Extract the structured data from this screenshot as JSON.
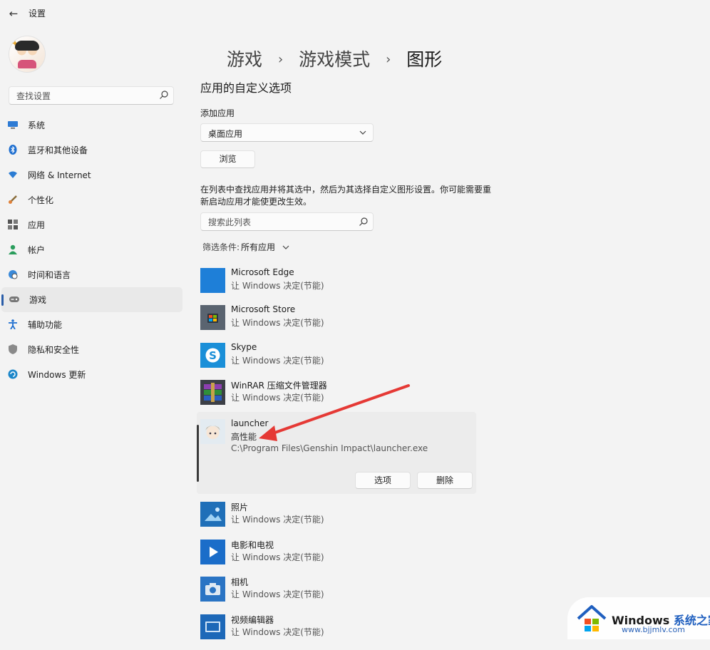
{
  "window": {
    "title": "设置",
    "back_icon": "back-arrow-icon"
  },
  "sidebar": {
    "search_placeholder": "查找设置",
    "items": [
      {
        "label": "系统",
        "icon": "monitor-icon",
        "active": false
      },
      {
        "label": "蓝牙和其他设备",
        "icon": "bluetooth-icon",
        "active": false
      },
      {
        "label": "网络 & Internet",
        "icon": "wifi-icon",
        "active": false
      },
      {
        "label": "个性化",
        "icon": "brush-icon",
        "active": false
      },
      {
        "label": "应用",
        "icon": "apps-icon",
        "active": false
      },
      {
        "label": "帐户",
        "icon": "person-icon",
        "active": false
      },
      {
        "label": "时间和语言",
        "icon": "globe-clock-icon",
        "active": false
      },
      {
        "label": "游戏",
        "icon": "gamepad-icon",
        "active": true
      },
      {
        "label": "辅助功能",
        "icon": "accessibility-icon",
        "active": false
      },
      {
        "label": "隐私和安全性",
        "icon": "shield-icon",
        "active": false
      },
      {
        "label": "Windows 更新",
        "icon": "update-icon",
        "active": false
      }
    ]
  },
  "breadcrumb": {
    "level1": "游戏",
    "level2": "游戏模式",
    "current": "图形",
    "separator": "›"
  },
  "main": {
    "section_title": "应用的自定义选项",
    "add_app_label": "添加应用",
    "add_app_dropdown_value": "桌面应用",
    "browse_button": "浏览",
    "description": "在列表中查找应用并将其选中，然后为其选择自定义图形设置。你可能需要重新启动应用才能使更改生效。",
    "list_search_placeholder": "搜索此列表",
    "filter_label": "筛选条件:",
    "filter_value": "所有应用"
  },
  "apps": [
    {
      "name": "Microsoft Edge",
      "preference": "让 Windows 决定(节能)",
      "icon": "edge-icon"
    },
    {
      "name": "Microsoft Store",
      "preference": "让 Windows 决定(节能)",
      "icon": "store-icon"
    },
    {
      "name": "Skype",
      "preference": "让 Windows 决定(节能)",
      "icon": "skype-icon"
    },
    {
      "name": "WinRAR 压缩文件管理器",
      "preference": "让 Windows 决定(节能)",
      "icon": "winrar-icon"
    }
  ],
  "expanded_app": {
    "name": "launcher",
    "preference": "高性能",
    "path": "C:\\Program Files\\Genshin Impact\\launcher.exe",
    "options_button": "选项",
    "delete_button": "删除",
    "icon": "launcher-icon"
  },
  "apps_after": [
    {
      "name": "照片",
      "preference": "让 Windows 决定(节能)",
      "icon": "photos-icon"
    },
    {
      "name": "电影和电视",
      "preference": "让 Windows 决定(节能)",
      "icon": "movies-tv-icon"
    },
    {
      "name": "相机",
      "preference": "让 Windows 决定(节能)",
      "icon": "camera-icon"
    },
    {
      "name": "视频编辑器",
      "preference": "让 Windows 决定(节能)",
      "icon": "video-editor-icon"
    }
  ],
  "watermark": {
    "brand": "Windows",
    "brand_cn": "系统之家",
    "url": "www.bjjmlv.com"
  },
  "colors": {
    "accent": "#2a5da8",
    "annotation_arrow": "#e53935",
    "background": "#f3f3f3"
  }
}
